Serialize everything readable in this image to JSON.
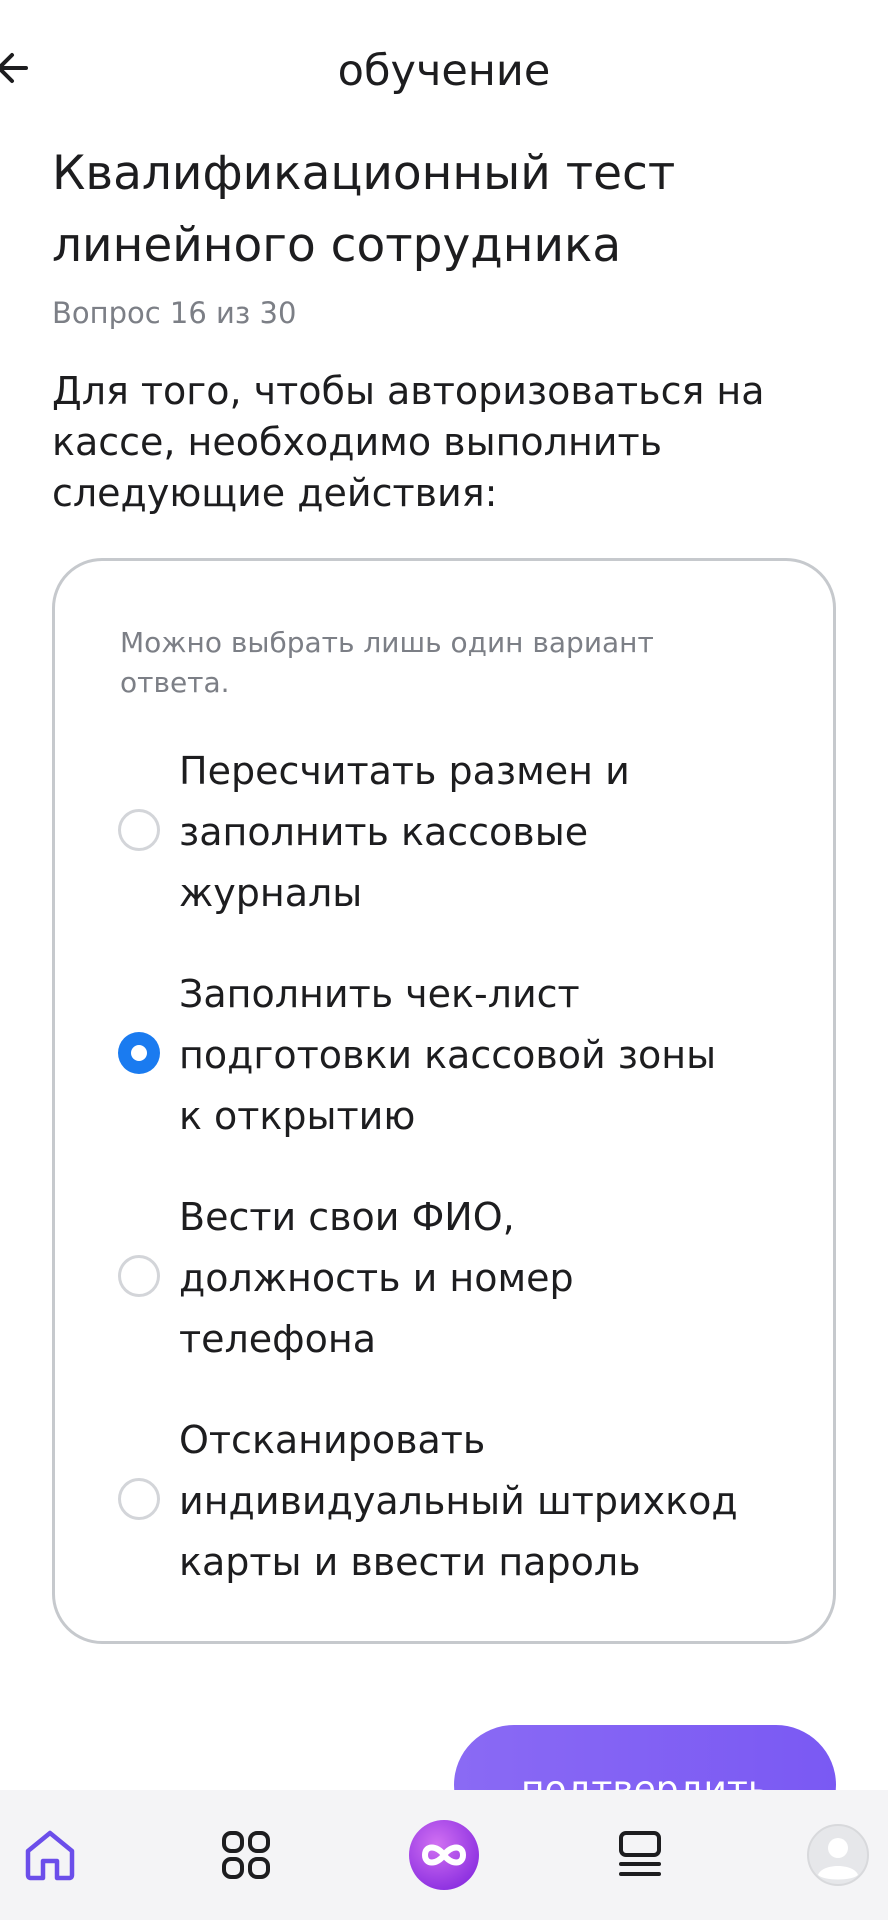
{
  "header": {
    "title": "обучение",
    "back_icon": "arrow-left-icon"
  },
  "test": {
    "title_line1": "Квалификационный тест",
    "title_line2": "линейного сотрудника",
    "counter": "Вопрос 16 из 30",
    "question_line1": "Для того, чтобы авторизоваться на",
    "question_line2": "кассе, необходимо выполнить",
    "question_line3": "следующие действия:"
  },
  "answers": {
    "hint_line1": "Можно выбрать лишь один вариант",
    "hint_line2": "ответа.",
    "selected_index": 1,
    "options": [
      {
        "line1": "Пересчитать размен и",
        "line2": "заполнить кассовые",
        "line3": "журналы",
        "selected": false
      },
      {
        "line1": "Заполнить чек-лист",
        "line2": "подготовки кассовой зоны",
        "line3": "к открытию",
        "selected": true
      },
      {
        "line1": "Вести свои ФИО,",
        "line2": "должность и номер",
        "line3": "телефона",
        "selected": false
      },
      {
        "line1": "Отсканировать",
        "line2": "индивидуальный штрихкод",
        "line3": "карты и ввести пароль",
        "selected": false
      }
    ]
  },
  "actions": {
    "confirm_label": "подтвердить"
  },
  "bottom_nav": {
    "items": [
      "home-icon",
      "grid-icon",
      "infinity-logo-icon",
      "catalog-icon",
      "profile-avatar-icon"
    ],
    "active": "home-icon"
  },
  "colors": {
    "accent_blue": "#1a7bf0",
    "accent_purple": "#7a59f3",
    "nav_active": "#6b4eea",
    "text_primary": "#1d1d1f",
    "text_secondary": "#7c7f86"
  }
}
